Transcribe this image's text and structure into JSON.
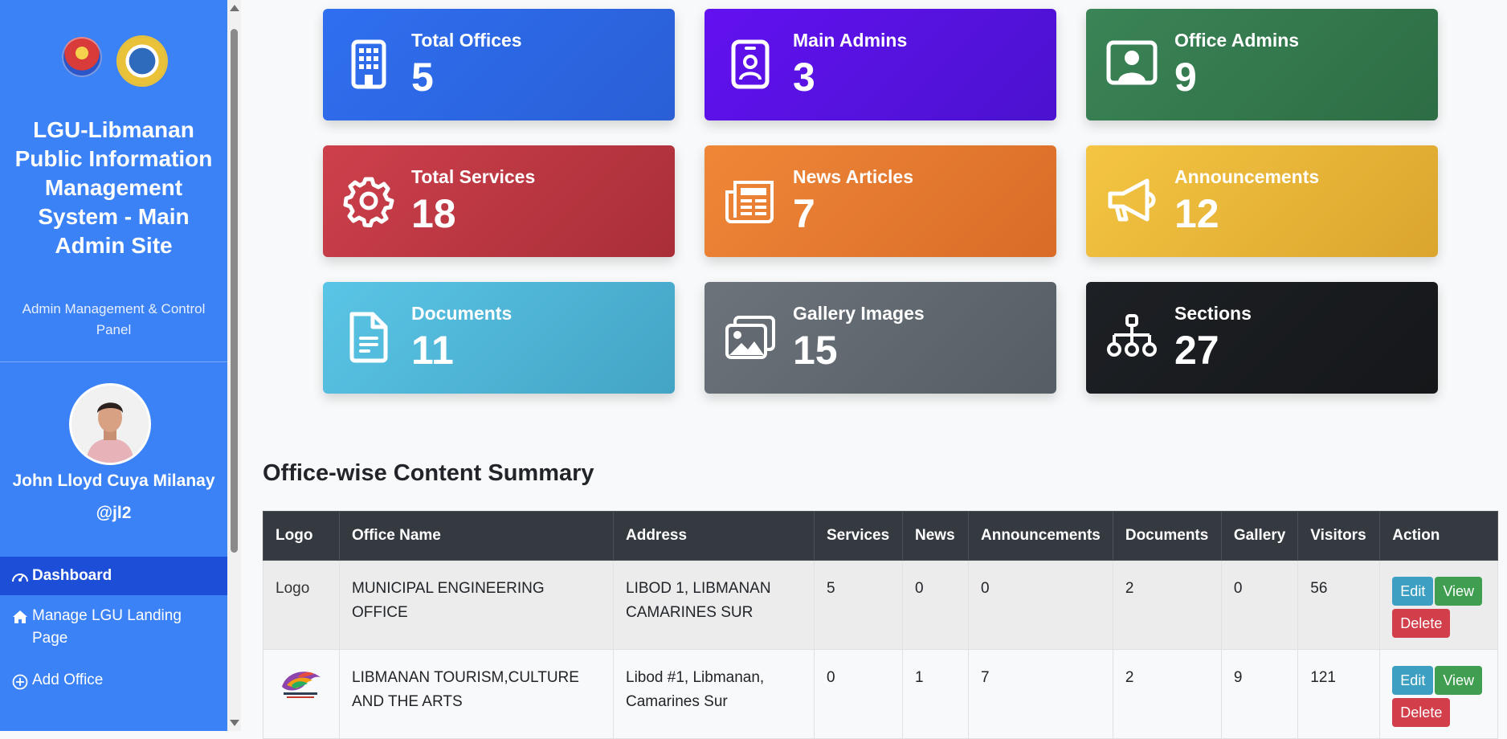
{
  "sidebar": {
    "title": "LGU-Libmanan Public Information Management System - Main Admin Site",
    "subtitle": "Admin Management & Control Panel",
    "user_name": "John Lloyd Cuya Milanay",
    "user_handle": "@jl2",
    "nav": [
      {
        "label": "Dashboard",
        "icon": "dashboard-icon",
        "active": true
      },
      {
        "label": "Manage LGU Landing Page",
        "icon": "home-icon"
      },
      {
        "label": "Add Office",
        "icon": "plus-circle-icon"
      }
    ]
  },
  "stats": [
    {
      "label": "Total Offices",
      "value": "5",
      "icon": "building-icon",
      "color": "#2f6ff0"
    },
    {
      "label": "Main Admins",
      "value": "3",
      "icon": "id-badge-icon",
      "color": "#6211f0"
    },
    {
      "label": "Office Admins",
      "value": "9",
      "icon": "person-screen-icon",
      "color": "#3a8456"
    },
    {
      "label": "Total Services",
      "value": "18",
      "icon": "gear-icon",
      "color": "#cd404c"
    },
    {
      "label": "News Articles",
      "value": "7",
      "icon": "newspaper-icon",
      "color": "#ef8737"
    },
    {
      "label": "Announcements",
      "value": "12",
      "icon": "megaphone-icon",
      "color": "#f4c542"
    },
    {
      "label": "Documents",
      "value": "11",
      "icon": "document-icon",
      "color": "#5ac5e6"
    },
    {
      "label": "Gallery Images",
      "value": "15",
      "icon": "images-icon",
      "color": "#6c737b"
    },
    {
      "label": "Sections",
      "value": "27",
      "icon": "sitemap-icon",
      "color": "#1d2024"
    }
  ],
  "summary": {
    "title": "Office-wise Content Summary",
    "columns": [
      "Logo",
      "Office Name",
      "Address",
      "Services",
      "News",
      "Announcements",
      "Documents",
      "Gallery",
      "Visitors",
      "Action"
    ],
    "rows": [
      {
        "logo_alt": "Logo",
        "office": "MUNICIPAL ENGINEERING OFFICE",
        "address": "LIBOD 1, LIBMANAN CAMARINES SUR",
        "services": "5",
        "news": "0",
        "announcements": "0",
        "documents": "2",
        "gallery": "0",
        "visitors": "56"
      },
      {
        "logo_alt": "",
        "office": "LIBMANAN TOURISM,CULTURE AND THE ARTS",
        "address": "Libod #1, Libmanan, Camarines Sur",
        "services": "0",
        "news": "1",
        "announcements": "7",
        "documents": "2",
        "gallery": "9",
        "visitors": "121"
      }
    ],
    "actions": {
      "edit": "Edit",
      "view": "View",
      "delete": "Delete"
    }
  }
}
